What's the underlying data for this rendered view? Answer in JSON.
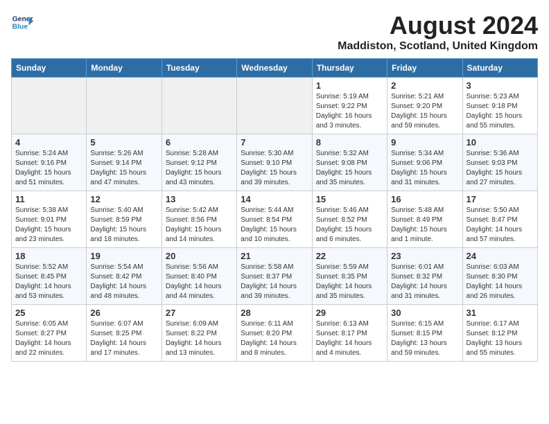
{
  "header": {
    "logo_line1": "General",
    "logo_line2": "Blue",
    "title": "August 2024",
    "subtitle": "Maddiston, Scotland, United Kingdom"
  },
  "weekdays": [
    "Sunday",
    "Monday",
    "Tuesday",
    "Wednesday",
    "Thursday",
    "Friday",
    "Saturday"
  ],
  "weeks": [
    [
      {
        "day": "",
        "info": ""
      },
      {
        "day": "",
        "info": ""
      },
      {
        "day": "",
        "info": ""
      },
      {
        "day": "",
        "info": ""
      },
      {
        "day": "1",
        "info": "Sunrise: 5:19 AM\nSunset: 9:22 PM\nDaylight: 16 hours\nand 3 minutes."
      },
      {
        "day": "2",
        "info": "Sunrise: 5:21 AM\nSunset: 9:20 PM\nDaylight: 15 hours\nand 59 minutes."
      },
      {
        "day": "3",
        "info": "Sunrise: 5:23 AM\nSunset: 9:18 PM\nDaylight: 15 hours\nand 55 minutes."
      }
    ],
    [
      {
        "day": "4",
        "info": "Sunrise: 5:24 AM\nSunset: 9:16 PM\nDaylight: 15 hours\nand 51 minutes."
      },
      {
        "day": "5",
        "info": "Sunrise: 5:26 AM\nSunset: 9:14 PM\nDaylight: 15 hours\nand 47 minutes."
      },
      {
        "day": "6",
        "info": "Sunrise: 5:28 AM\nSunset: 9:12 PM\nDaylight: 15 hours\nand 43 minutes."
      },
      {
        "day": "7",
        "info": "Sunrise: 5:30 AM\nSunset: 9:10 PM\nDaylight: 15 hours\nand 39 minutes."
      },
      {
        "day": "8",
        "info": "Sunrise: 5:32 AM\nSunset: 9:08 PM\nDaylight: 15 hours\nand 35 minutes."
      },
      {
        "day": "9",
        "info": "Sunrise: 5:34 AM\nSunset: 9:06 PM\nDaylight: 15 hours\nand 31 minutes."
      },
      {
        "day": "10",
        "info": "Sunrise: 5:36 AM\nSunset: 9:03 PM\nDaylight: 15 hours\nand 27 minutes."
      }
    ],
    [
      {
        "day": "11",
        "info": "Sunrise: 5:38 AM\nSunset: 9:01 PM\nDaylight: 15 hours\nand 23 minutes."
      },
      {
        "day": "12",
        "info": "Sunrise: 5:40 AM\nSunset: 8:59 PM\nDaylight: 15 hours\nand 18 minutes."
      },
      {
        "day": "13",
        "info": "Sunrise: 5:42 AM\nSunset: 8:56 PM\nDaylight: 15 hours\nand 14 minutes."
      },
      {
        "day": "14",
        "info": "Sunrise: 5:44 AM\nSunset: 8:54 PM\nDaylight: 15 hours\nand 10 minutes."
      },
      {
        "day": "15",
        "info": "Sunrise: 5:46 AM\nSunset: 8:52 PM\nDaylight: 15 hours\nand 6 minutes."
      },
      {
        "day": "16",
        "info": "Sunrise: 5:48 AM\nSunset: 8:49 PM\nDaylight: 15 hours\nand 1 minute."
      },
      {
        "day": "17",
        "info": "Sunrise: 5:50 AM\nSunset: 8:47 PM\nDaylight: 14 hours\nand 57 minutes."
      }
    ],
    [
      {
        "day": "18",
        "info": "Sunrise: 5:52 AM\nSunset: 8:45 PM\nDaylight: 14 hours\nand 53 minutes."
      },
      {
        "day": "19",
        "info": "Sunrise: 5:54 AM\nSunset: 8:42 PM\nDaylight: 14 hours\nand 48 minutes."
      },
      {
        "day": "20",
        "info": "Sunrise: 5:56 AM\nSunset: 8:40 PM\nDaylight: 14 hours\nand 44 minutes."
      },
      {
        "day": "21",
        "info": "Sunrise: 5:58 AM\nSunset: 8:37 PM\nDaylight: 14 hours\nand 39 minutes."
      },
      {
        "day": "22",
        "info": "Sunrise: 5:59 AM\nSunset: 8:35 PM\nDaylight: 14 hours\nand 35 minutes."
      },
      {
        "day": "23",
        "info": "Sunrise: 6:01 AM\nSunset: 8:32 PM\nDaylight: 14 hours\nand 31 minutes."
      },
      {
        "day": "24",
        "info": "Sunrise: 6:03 AM\nSunset: 8:30 PM\nDaylight: 14 hours\nand 26 minutes."
      }
    ],
    [
      {
        "day": "25",
        "info": "Sunrise: 6:05 AM\nSunset: 8:27 PM\nDaylight: 14 hours\nand 22 minutes."
      },
      {
        "day": "26",
        "info": "Sunrise: 6:07 AM\nSunset: 8:25 PM\nDaylight: 14 hours\nand 17 minutes."
      },
      {
        "day": "27",
        "info": "Sunrise: 6:09 AM\nSunset: 8:22 PM\nDaylight: 14 hours\nand 13 minutes."
      },
      {
        "day": "28",
        "info": "Sunrise: 6:11 AM\nSunset: 8:20 PM\nDaylight: 14 hours\nand 8 minutes."
      },
      {
        "day": "29",
        "info": "Sunrise: 6:13 AM\nSunset: 8:17 PM\nDaylight: 14 hours\nand 4 minutes."
      },
      {
        "day": "30",
        "info": "Sunrise: 6:15 AM\nSunset: 8:15 PM\nDaylight: 13 hours\nand 59 minutes."
      },
      {
        "day": "31",
        "info": "Sunrise: 6:17 AM\nSunset: 8:12 PM\nDaylight: 13 hours\nand 55 minutes."
      }
    ]
  ]
}
